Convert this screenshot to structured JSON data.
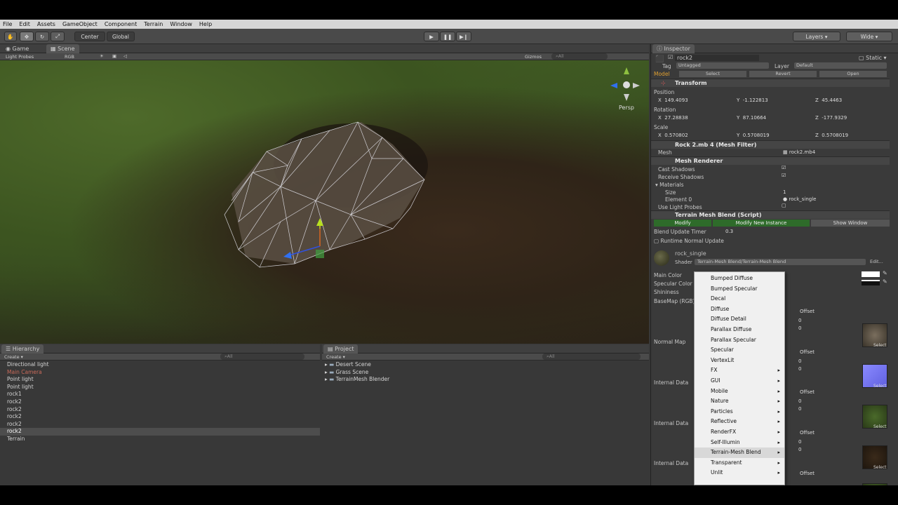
{
  "menubar": [
    "File",
    "Edit",
    "Assets",
    "GameObject",
    "Component",
    "Terrain",
    "Window",
    "Help"
  ],
  "toolbar": {
    "pivot": "Center",
    "space": "Global",
    "layers": "Layers",
    "layout": "Wide"
  },
  "scene_panel": {
    "tabs": [
      "Game",
      "Scene"
    ],
    "render_mode": "Light Probes",
    "color_mode": "RGB",
    "gizmos": "Gizmos",
    "search": "All",
    "projection": "Persp"
  },
  "hierarchy": {
    "title": "Hierarchy",
    "create": "Create",
    "search": "All",
    "items": [
      {
        "label": "Directional light",
        "state": "normal"
      },
      {
        "label": "Main Camera",
        "state": "red"
      },
      {
        "label": "Point light",
        "state": "normal"
      },
      {
        "label": "Point light",
        "state": "normal"
      },
      {
        "label": "rock1",
        "state": "normal"
      },
      {
        "label": "rock2",
        "state": "normal"
      },
      {
        "label": "rock2",
        "state": "normal"
      },
      {
        "label": "rock2",
        "state": "normal"
      },
      {
        "label": "rock2",
        "state": "normal"
      },
      {
        "label": "rock2",
        "state": "selected"
      },
      {
        "label": "Terrain",
        "state": "normal"
      }
    ]
  },
  "project": {
    "title": "Project",
    "create": "Create",
    "search": "All",
    "folders": [
      "Desert Scene",
      "Grass Scene",
      "TerrainMesh Blender"
    ]
  },
  "inspector": {
    "title": "Inspector",
    "object_name": "rock2",
    "static_label": "Static",
    "tag_label": "Tag",
    "tag_value": "Untagged",
    "layer_label": "Layer",
    "layer_value": "Default",
    "model_label": "Model",
    "select": "Select",
    "revert": "Revert",
    "open": "Open",
    "transform": {
      "title": "Transform",
      "position_label": "Position",
      "position": {
        "x": "149.4093",
        "y": "-1.122813",
        "z": "45.4463"
      },
      "rotation_label": "Rotation",
      "rotation": {
        "x": "27.28838",
        "y": "87.10664",
        "z": "-177.9329"
      },
      "scale_label": "Scale",
      "scale": {
        "x": "0.570802",
        "y": "0.5708019",
        "z": "0.5708019"
      }
    },
    "mesh_filter": {
      "title": "Rock 2.mb 4 (Mesh Filter)",
      "mesh_label": "Mesh",
      "mesh_value": "rock2.mb4"
    },
    "mesh_renderer": {
      "title": "Mesh Renderer",
      "cast_shadows": "Cast Shadows",
      "receive_shadows": "Receive Shadows",
      "materials": "Materials",
      "size_label": "Size",
      "size_value": "1",
      "element0_label": "Element 0",
      "element0_value": "rock_single",
      "use_light_probes": "Use Light Probes"
    },
    "terrain_blend": {
      "title": "Terrain Mesh Blend (Script)",
      "modify": "Modify",
      "modify_new": "Modify New Instance",
      "show_window": "Show Window",
      "timer_label": "Blend Update Timer",
      "timer_value": "0.3",
      "runtime": "Runtime Normal Update"
    },
    "material": {
      "name": "rock_single",
      "shader_label": "Shader",
      "shader_value": "Terrain-Mesh Blend/Terrain-Mesh Blend",
      "edit": "Edit...",
      "props": [
        "Main Color",
        "Specular Color",
        "Shininess",
        "BaseMap (RGB)",
        "Normal Map",
        "Internal Data",
        "Internal Data",
        "Internal Data"
      ],
      "offset": "Offset",
      "zero": "0",
      "select": "Select"
    }
  },
  "shader_menu": {
    "items": [
      {
        "label": "Bumped Diffuse",
        "sub": false
      },
      {
        "label": "Bumped Specular",
        "sub": false
      },
      {
        "label": "Decal",
        "sub": false
      },
      {
        "label": "Diffuse",
        "sub": false
      },
      {
        "label": "Diffuse Detail",
        "sub": false
      },
      {
        "label": "Parallax Diffuse",
        "sub": false
      },
      {
        "label": "Parallax Specular",
        "sub": false
      },
      {
        "label": "Specular",
        "sub": false
      },
      {
        "label": "VertexLit",
        "sub": false
      },
      {
        "label": "FX",
        "sub": true
      },
      {
        "label": "GUI",
        "sub": true
      },
      {
        "label": "Mobile",
        "sub": true
      },
      {
        "label": "Nature",
        "sub": true
      },
      {
        "label": "Particles",
        "sub": true
      },
      {
        "label": "Reflective",
        "sub": true
      },
      {
        "label": "RenderFX",
        "sub": true
      },
      {
        "label": "Self-Illumin",
        "sub": true
      },
      {
        "label": "Terrain-Mesh Blend",
        "sub": true
      },
      {
        "label": "Transparent",
        "sub": true
      },
      {
        "label": "Unlit",
        "sub": true
      }
    ],
    "highlighted": "Terrain-Mesh Blend",
    "arrow": "▸"
  },
  "colors": {
    "accent_green": "#2e6b2a",
    "menu_bg": "#f0f0f0",
    "panel": "#383838"
  }
}
